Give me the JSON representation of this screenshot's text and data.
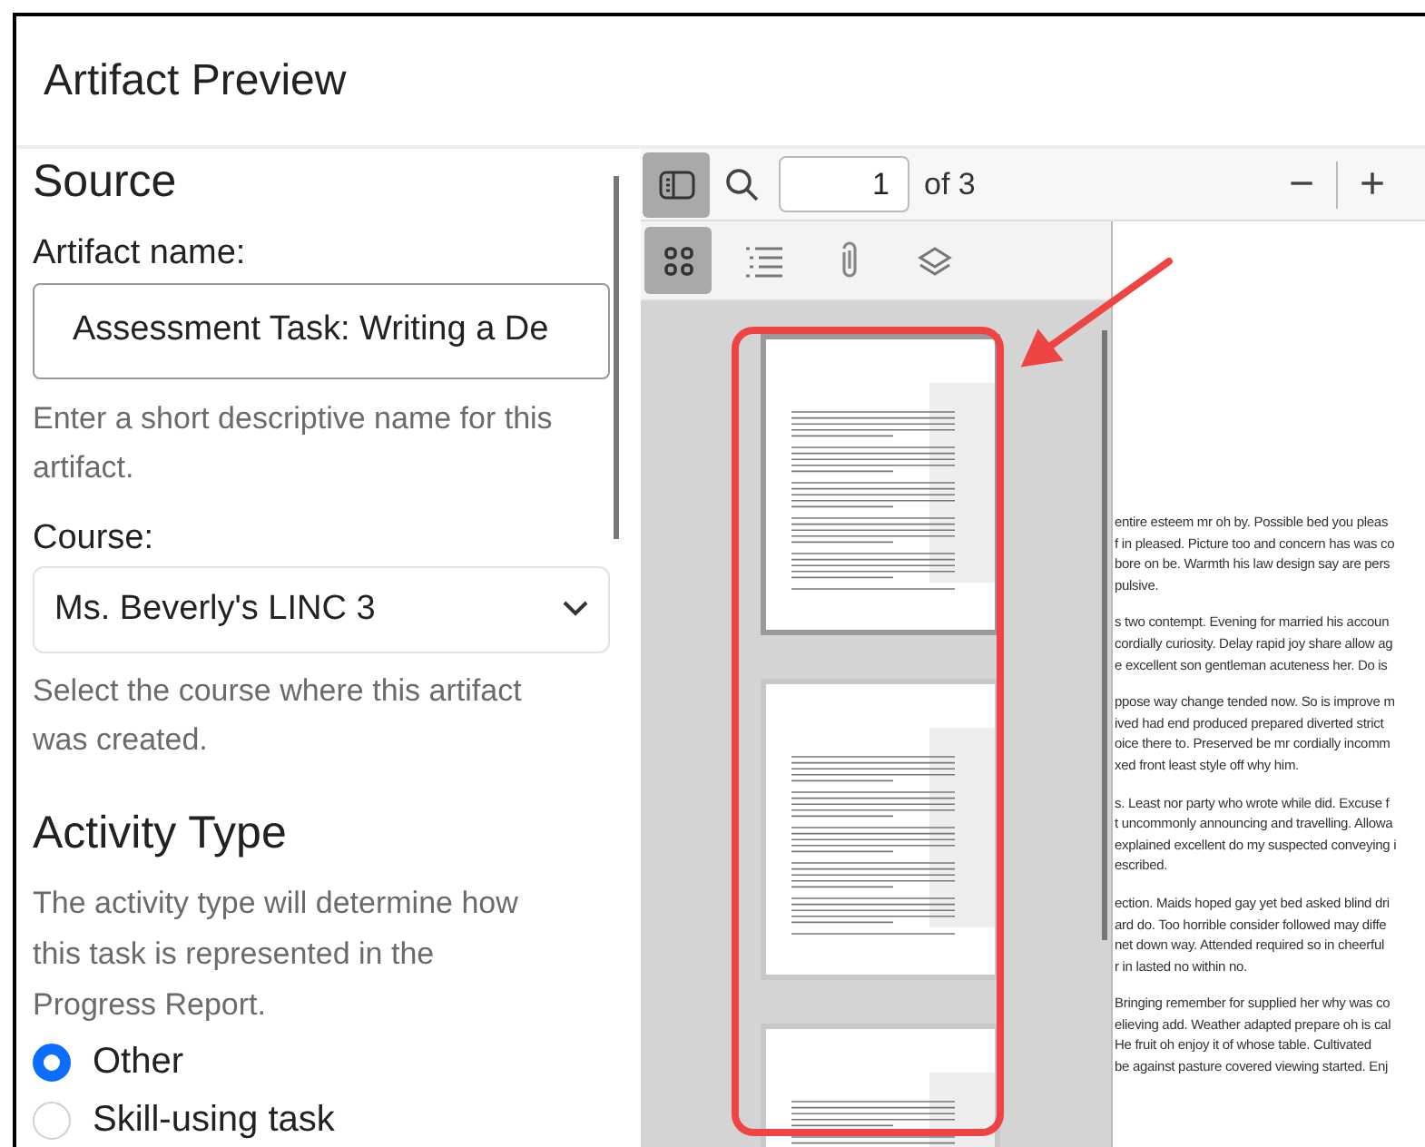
{
  "window": {
    "title": "Artifact Preview"
  },
  "form": {
    "section_title": "Source",
    "artifact_name": {
      "label": "Artifact name:",
      "value": "Assessment Task: Writing a De",
      "help": "Enter a short descriptive name for this artifact."
    },
    "course": {
      "label": "Course:",
      "value": "Ms. Beverly's LINC 3",
      "help": "Select the course where this artifact was created."
    },
    "activity_type": {
      "title": "Activity Type",
      "help": "The activity type will determine how this task is represented in the Progress Report.",
      "options": [
        {
          "label": "Other",
          "selected": true
        },
        {
          "label": "Skill-using task",
          "selected": false
        }
      ]
    }
  },
  "viewer": {
    "sidebar_toggle": {
      "on": true
    },
    "page_input": "1",
    "page_count": "of 3",
    "zoom_out": "−",
    "zoom_in": "+",
    "sidebar_tabs": [
      {
        "kind": "thumbnails",
        "selected": true
      },
      {
        "kind": "outline",
        "selected": false
      },
      {
        "kind": "attachments",
        "selected": false
      },
      {
        "kind": "layers",
        "selected": false
      }
    ],
    "thumbnails": [
      {
        "selected": true
      },
      {
        "selected": false
      },
      {
        "selected": false
      }
    ],
    "document_paragraphs": [
      [
        "entire esteem mr oh by. Possible bed you pleas",
        "f in pleased. Picture too and concern has was co",
        "bore on be. Warmth his law design say are pers",
        "pulsive."
      ],
      [
        "s two contempt. Evening for married his accoun",
        "cordially curiosity. Delay rapid joy share allow ag",
        "e excellent son gentleman acuteness her. Do is"
      ],
      [
        "ppose way change tended now. So is improve m",
        "ived had end produced prepared diverted strict",
        "oice there to. Preserved be mr cordially incomm",
        "xed front least style off why him."
      ],
      [
        "s. Least nor party who wrote while did. Excuse f",
        "t uncommonly announcing and travelling. Allowa",
        "explained excellent do my suspected conveying i",
        "escribed."
      ],
      [
        "ection. Maids hoped gay yet bed asked blind dri",
        "ard do. Too horrible consider followed may diffe",
        "net down way. Attended required so in cheerful",
        "r in lasted no within no."
      ],
      [
        "Bringing remember for supplied her why was co",
        "elieving add. Weather adapted prepare oh is cal",
        "He fruit oh enjoy it of whose table. Cultivated",
        "be against pasture covered viewing started. Enj"
      ]
    ]
  },
  "annotation": {
    "color": "#ef4444"
  }
}
